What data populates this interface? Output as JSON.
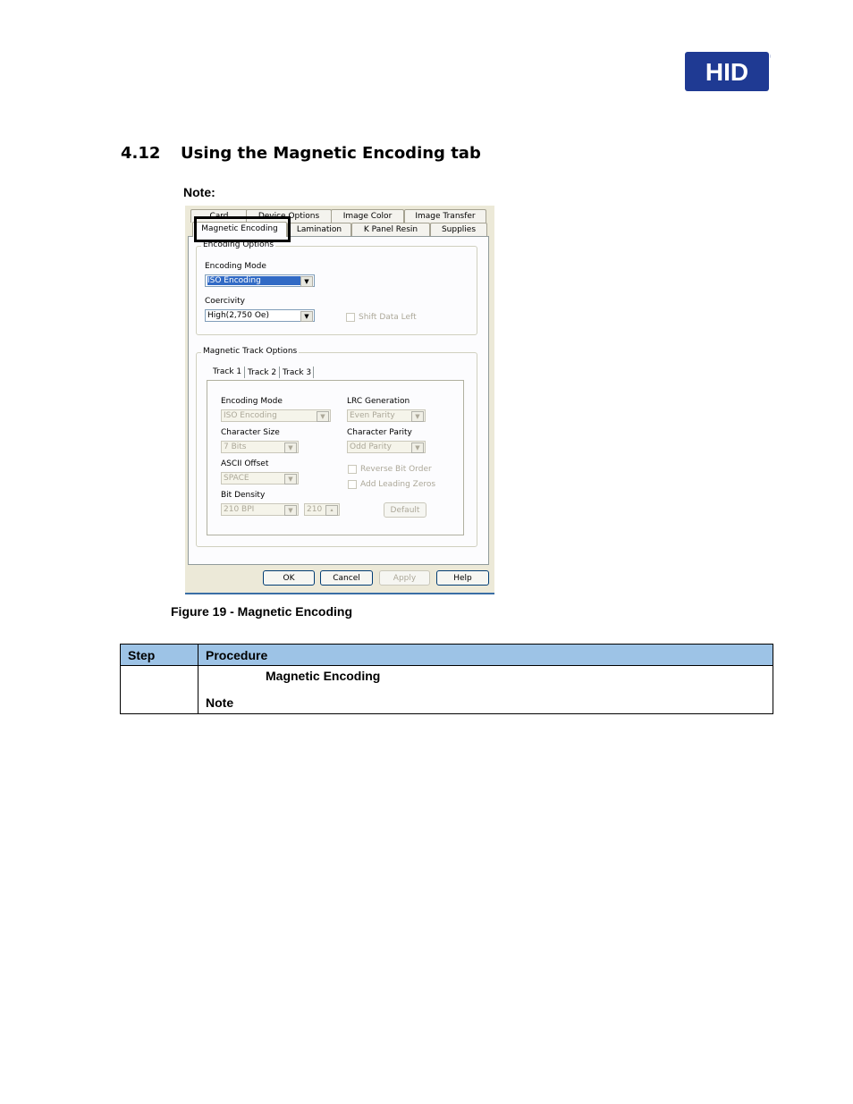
{
  "logo": {
    "text": "HID",
    "color": "#1f3a93"
  },
  "section": {
    "number": "4.12",
    "title": "Using the Magnetic Encoding tab"
  },
  "note_label": "Note:",
  "dialog": {
    "tabs_row1": [
      "Card",
      "Device Options",
      "Image Color",
      "Image Transfer"
    ],
    "tabs_row2": [
      "Magnetic Encoding",
      "Lamination",
      "K Panel Resin",
      "Supplies"
    ],
    "encoding_options": {
      "title": "Encoding Options",
      "encoding_mode_label": "Encoding Mode",
      "encoding_mode_value": "ISO Encoding",
      "coercivity_label": "Coercivity",
      "coercivity_value": "High(2,750 Oe)",
      "shift_data_left": "Shift Data Left"
    },
    "track_options": {
      "title": "Magnetic Track Options",
      "tracks": [
        "Track 1",
        "Track 2",
        "Track 3"
      ],
      "encoding_mode_label": "Encoding Mode",
      "encoding_mode_value": "ISO Encoding",
      "lrc_label": "LRC Generation",
      "lrc_value": "Even Parity",
      "char_size_label": "Character Size",
      "char_size_value": "7 Bits",
      "char_parity_label": "Character Parity",
      "char_parity_value": "Odd Parity",
      "ascii_offset_label": "ASCII Offset",
      "ascii_offset_value": "SPACE",
      "reverse_bit_order": "Reverse Bit Order",
      "add_leading_zeros": "Add Leading Zeros",
      "bit_density_label": "Bit Density",
      "bit_density_value": "210 BPI",
      "bit_density_number": "210",
      "default_button": "Default"
    },
    "buttons": {
      "ok": "OK",
      "cancel": "Cancel",
      "apply": "Apply",
      "help": "Help"
    }
  },
  "figure_caption": "Figure 19 - Magnetic Encoding",
  "table": {
    "headers": {
      "step": "Step",
      "procedure": "Procedure"
    },
    "row": {
      "step": "",
      "line1": "Magnetic Encoding",
      "line2": "Note"
    },
    "header_color": "#9dc3e6"
  }
}
